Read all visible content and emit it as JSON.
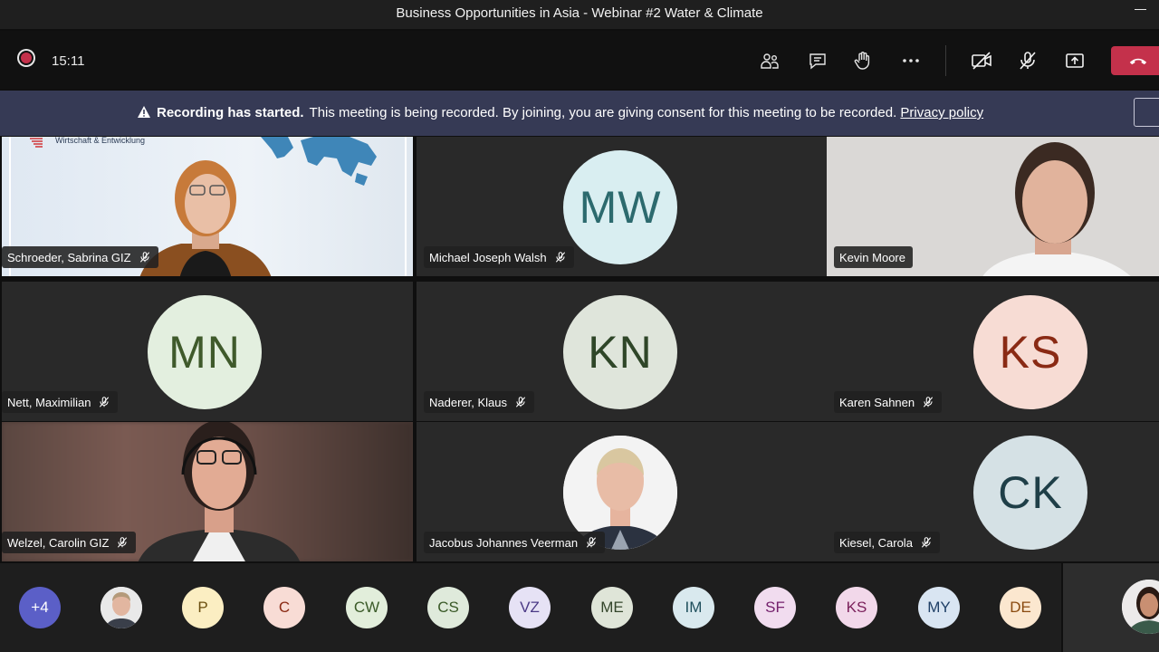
{
  "window": {
    "title": "Business Opportunities in Asia - Webinar #2 Water & Climate"
  },
  "controls": {
    "timer": "15:11",
    "buttons": [
      "participants-icon",
      "chat-icon",
      "raise-hand-icon",
      "more-icon",
      "camera-off-icon",
      "mic-off-icon",
      "share-icon",
      "hangup-icon"
    ]
  },
  "banner": {
    "strong": "Recording has started.",
    "text": "This meeting is being recorded. By joining, you are giving consent for this meeting to be recorded.",
    "link": "Privacy policy"
  },
  "slide": {
    "brand": "Wirtschaft & Entwicklung"
  },
  "tiles": [
    {
      "name": "Schroeder, Sabrina GIZ",
      "muted": true,
      "type": "video"
    },
    {
      "name": "Michael Joseph Walsh",
      "muted": true,
      "initials": "MW",
      "bg": "#d9eef1",
      "fg": "#2c6a6e"
    },
    {
      "name": "Kevin Moore",
      "muted": false,
      "type": "video"
    },
    {
      "name": "Nett, Maximilian",
      "muted": true,
      "initials": "MN",
      "bg": "#e3efdf",
      "fg": "#3f5a2b"
    },
    {
      "name": "Naderer, Klaus",
      "muted": true,
      "initials": "KN",
      "bg": "#dfe5db",
      "fg": "#2f4628"
    },
    {
      "name": "Karen Sahnen",
      "muted": true,
      "initials": "KS",
      "bg": "#f7dcd4",
      "fg": "#8a2a14"
    },
    {
      "name": "Welzel, Carolin GIZ",
      "muted": true,
      "type": "video"
    },
    {
      "name": "Jacobus Johannes Veerman",
      "muted": true,
      "type": "photo"
    },
    {
      "name": "Kiesel, Carola",
      "muted": true,
      "initials": "CK",
      "bg": "#d5e1e5",
      "fg": "#1f3f48"
    }
  ],
  "strip": [
    {
      "label": "+4",
      "bg": "#5b5fc7",
      "fg": "#ffffff"
    },
    {
      "label": "",
      "bg": "#d8d8d8",
      "fg": "#333333"
    },
    {
      "label": "P",
      "bg": "#fbeec2",
      "fg": "#6b4f10"
    },
    {
      "label": "C",
      "bg": "#f8dcd5",
      "fg": "#8a2a14"
    },
    {
      "label": "CW",
      "bg": "#e2eedb",
      "fg": "#3a5a28"
    },
    {
      "label": "CS",
      "bg": "#dfeadb",
      "fg": "#3a5a28"
    },
    {
      "label": "VZ",
      "bg": "#e6e2f5",
      "fg": "#4b3a86"
    },
    {
      "label": "ME",
      "bg": "#dfe5d8",
      "fg": "#33452a"
    },
    {
      "label": "IM",
      "bg": "#d9e9ee",
      "fg": "#1f4f5c"
    },
    {
      "label": "SF",
      "bg": "#f1dcef",
      "fg": "#74206c"
    },
    {
      "label": "KS",
      "bg": "#f2d8ea",
      "fg": "#7a1f5a"
    },
    {
      "label": "MY",
      "bg": "#d9e5f2",
      "fg": "#1f3f66"
    },
    {
      "label": "DE",
      "bg": "#fbe7cf",
      "fg": "#8a4b10"
    }
  ]
}
